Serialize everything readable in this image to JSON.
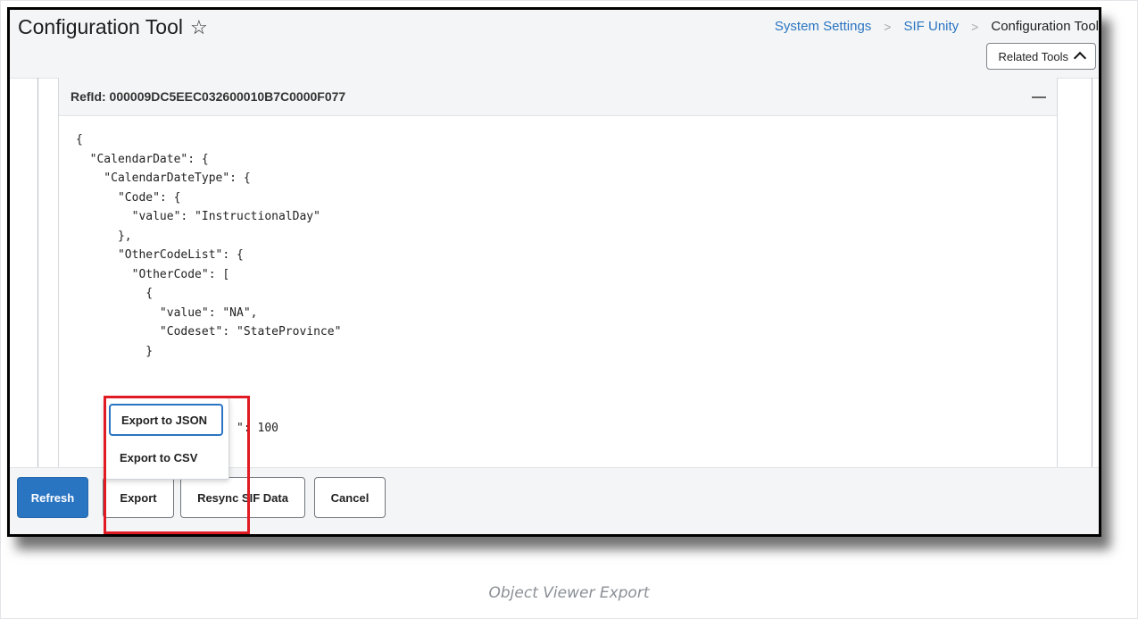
{
  "header": {
    "title": "Configuration Tool",
    "breadcrumb": [
      "System Settings",
      "SIF Unity",
      "Configuration Tool"
    ],
    "related_tools_label": "Related Tools"
  },
  "viewer": {
    "ref_label": "RefId: 000009DC5EEC032600010B7C0000F077",
    "json_text": "{\n  \"CalendarDate\": {\n    \"CalendarDateType\": {\n      \"Code\": {\n        \"value\": \"InstructionalDay\"\n      },\n      \"OtherCodeList\": {\n        \"OtherCode\": [\n          {\n            \"value\": \"NA\",\n            \"Codeset\": \"StateProvince\"\n          }\n\n\n\n                       \": 100"
  },
  "export_menu": {
    "items": [
      "Export to JSON",
      "Export to CSV"
    ]
  },
  "footer": {
    "refresh_label": "Refresh",
    "export_label": "Export",
    "resync_label": "Resync SIF Data",
    "cancel_label": "Cancel"
  },
  "caption": "Object Viewer Export",
  "colors": {
    "primary": "#2a75c2",
    "highlight": "#e01b24",
    "header_bg": "#f4f5f6"
  }
}
